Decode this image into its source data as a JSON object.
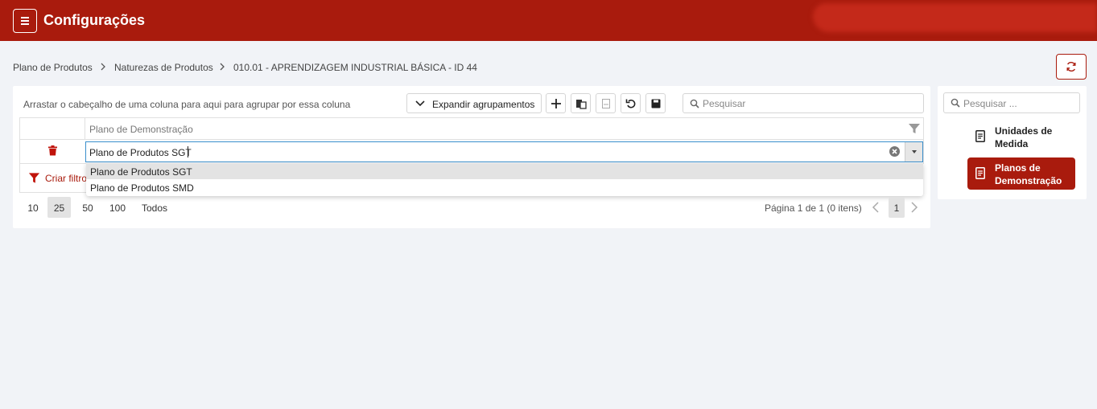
{
  "header": {
    "title": "Configurações"
  },
  "breadcrumb": {
    "items": [
      "Plano de Produtos",
      "Naturezas de Produtos",
      "010.01 - APRENDIZAGEM INDUSTRIAL BÁSICA - ID 44"
    ]
  },
  "toolbar": {
    "group_hint": "Arrastar o cabeçalho de uma coluna para aqui para agrupar por essa coluna",
    "expand_label": "Expandir agrupamentos",
    "search_placeholder": "Pesquisar"
  },
  "grid": {
    "column_header": "Plano de Demonstração",
    "editor_value": "Plano de Produtos SGT",
    "filter_label": "Criar filtro",
    "dropdown_options": [
      "Plano de Produtos SGT",
      "Plano de Produtos SMD"
    ]
  },
  "pager": {
    "sizes": [
      "10",
      "25",
      "50",
      "100",
      "Todos"
    ],
    "selected_size": "25",
    "info": "Página 1 de 1 (0 itens)",
    "current_page": "1"
  },
  "side_panel": {
    "search_placeholder": "Pesquisar ...",
    "items": [
      {
        "label": "Unidades de Medida",
        "active": false
      },
      {
        "label": "Planos de Demonstração",
        "active": true
      }
    ]
  },
  "colors": {
    "brand": "#a91b0d",
    "focus": "#3a8fcc"
  }
}
